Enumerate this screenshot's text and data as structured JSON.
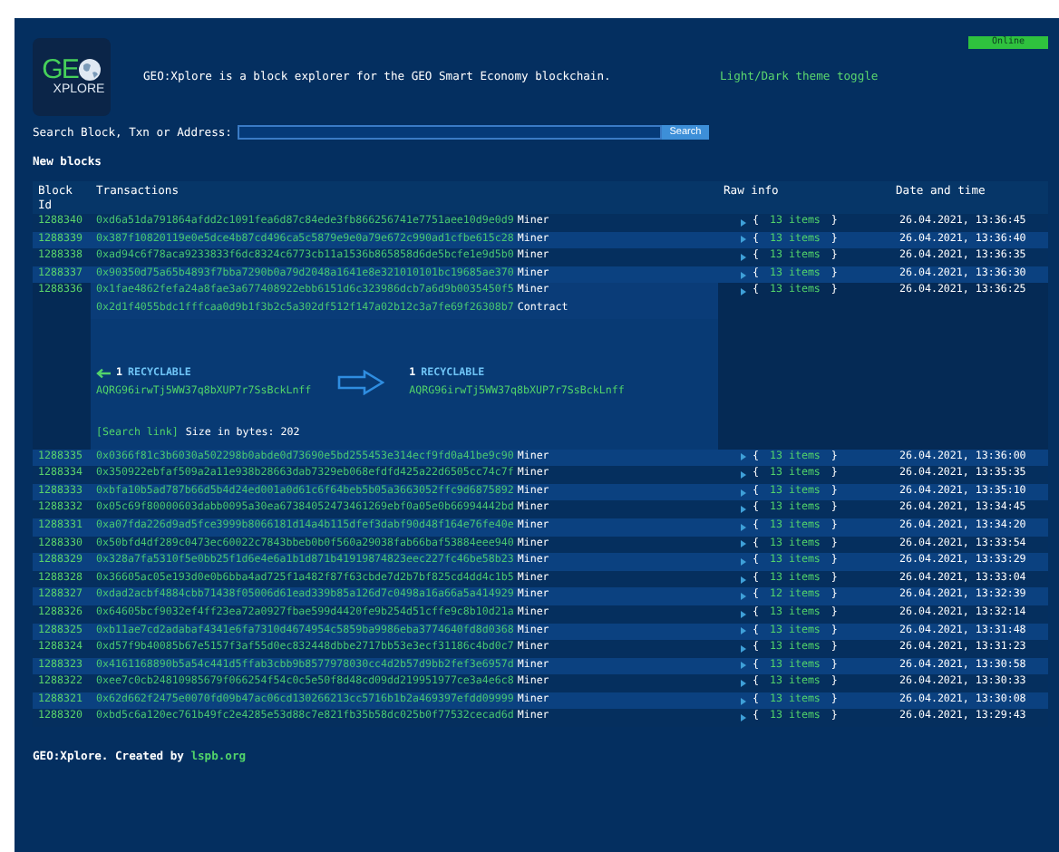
{
  "header": {
    "logo": {
      "top": "GE",
      "bottom": "XPLORE"
    },
    "description": "GEO:Xplore is a block explorer for the GEO Smart Economy blockchain.",
    "theme_toggle": "Light/Dark theme toggle",
    "status": "Online"
  },
  "search": {
    "label": "Search Block, Txn or Address:",
    "button": "Search"
  },
  "section_title": "New blocks",
  "table": {
    "columns": [
      "Block Id",
      "Transactions",
      "Raw info",
      "Date and time"
    ],
    "rows": [
      {
        "block_id": "1288340",
        "expanded": false,
        "transactions": [
          {
            "hash": "0xd6a51da791864afdd2c1091fea6d87c84ede3fb866256741e7751aee10d9e0d9",
            "type": "Miner"
          }
        ],
        "raw_info": {
          "expanded": false,
          "open": "{",
          "count": "13 items",
          "close": "}"
        },
        "date": "26.04.2021, 13:36:45"
      },
      {
        "block_id": "1288339",
        "expanded": false,
        "transactions": [
          {
            "hash": "0x387f10820119e0e5dce4b87cd496ca5c5879e9e0a79e672c990ad1cfbe615c28",
            "type": "Miner"
          }
        ],
        "raw_info": {
          "expanded": false,
          "open": "{",
          "count": "13 items",
          "close": "}"
        },
        "date": "26.04.2021, 13:36:40"
      },
      {
        "block_id": "1288338",
        "expanded": false,
        "transactions": [
          {
            "hash": "0xad94c6f78aca9233833f6dc8324c6773cb11a1536b865858d6de5bcfe1e9d5b0",
            "type": "Miner"
          }
        ],
        "raw_info": {
          "expanded": false,
          "open": "{",
          "count": "13 items",
          "close": "}"
        },
        "date": "26.04.2021, 13:36:35"
      },
      {
        "block_id": "1288337",
        "expanded": false,
        "transactions": [
          {
            "hash": "0x90350d75a65b4893f7bba7290b0a79d2048a1641e8e321010101bc19685ae370",
            "type": "Miner"
          }
        ],
        "raw_info": {
          "expanded": false,
          "open": "{",
          "count": "13 items",
          "close": "}"
        },
        "date": "26.04.2021, 13:36:30"
      },
      {
        "block_id": "1288336",
        "expanded": true,
        "transactions": [
          {
            "hash": "0x1fae4862fefa24a8fae3a677408922ebb6151d6c323986dcb7a6d9b0035450f5",
            "type": "Miner"
          },
          {
            "hash": "0x2d1f4055bdc1fffcaa0d9b1f3b2c5a302df512f147a02b12c3a7fe69f26308b7",
            "type": "Contract"
          }
        ],
        "details": {
          "inputs": [
            {
              "count": "1",
              "label": "RECYCLABLE",
              "address": "AQRG96irwTj5WW37q8bXUP7r7SsBckLnff"
            }
          ],
          "outputs": [
            {
              "count": "1",
              "label": "RECYCLABLE",
              "address": "AQRG96irwTj5WW37q8bXUP7r7SsBckLnff"
            }
          ],
          "search_link": "[Search link]",
          "size": "Size in bytes: 202"
        },
        "raw_info": {
          "expanded": false,
          "open": "{",
          "count": "13 items",
          "close": "}"
        },
        "date": "26.04.2021, 13:36:25"
      },
      {
        "block_id": "1288335",
        "expanded": false,
        "transactions": [
          {
            "hash": "0x0366f81c3b6030a502298b0abde0d73690e5bd255453e314ecf9fd0a41be9c90",
            "type": "Miner"
          }
        ],
        "raw_info": {
          "expanded": false,
          "open": "{",
          "count": "13 items",
          "close": "}"
        },
        "date": "26.04.2021, 13:36:00"
      },
      {
        "block_id": "1288334",
        "expanded": false,
        "transactions": [
          {
            "hash": "0x350922ebfaf509a2a11e938b28663dab7329eb068efdfd425a22d6505cc74c7f",
            "type": "Miner"
          }
        ],
        "raw_info": {
          "expanded": false,
          "open": "{",
          "count": "13 items",
          "close": "}"
        },
        "date": "26.04.2021, 13:35:35"
      },
      {
        "block_id": "1288333",
        "expanded": false,
        "transactions": [
          {
            "hash": "0xbfa10b5ad787b66d5b4d24ed001a0d61c6f64beb5b05a3663052ffc9d6875892",
            "type": "Miner"
          }
        ],
        "raw_info": {
          "expanded": false,
          "open": "{",
          "count": "13 items",
          "close": "}"
        },
        "date": "26.04.2021, 13:35:10"
      },
      {
        "block_id": "1288332",
        "expanded": false,
        "transactions": [
          {
            "hash": "0x05c69f80000603dabb0095a30ea67384052473461269ebf0a05e0b66994442bd",
            "type": "Miner"
          }
        ],
        "raw_info": {
          "expanded": false,
          "open": "{",
          "count": "13 items",
          "close": "}"
        },
        "date": "26.04.2021, 13:34:45"
      },
      {
        "block_id": "1288331",
        "expanded": false,
        "transactions": [
          {
            "hash": "0xa07fda226d9ad5fce3999b8066181d14a4b115dfef3dabf90d48f164e76fe40e",
            "type": "Miner"
          }
        ],
        "raw_info": {
          "expanded": false,
          "open": "{",
          "count": "13 items",
          "close": "}"
        },
        "date": "26.04.2021, 13:34:20"
      },
      {
        "block_id": "1288330",
        "expanded": false,
        "transactions": [
          {
            "hash": "0x50bfd4df289c0473ec60022c7843bbeb0b0f560a29038fab66baf53884eee940",
            "type": "Miner"
          }
        ],
        "raw_info": {
          "expanded": false,
          "open": "{",
          "count": "13 items",
          "close": "}"
        },
        "date": "26.04.2021, 13:33:54"
      },
      {
        "block_id": "1288329",
        "expanded": false,
        "transactions": [
          {
            "hash": "0x328a7fa5310f5e0bb25f1d6e4e6a1b1d871b41919874823eec227fc46be58b23",
            "type": "Miner"
          }
        ],
        "raw_info": {
          "expanded": false,
          "open": "{",
          "count": "13 items",
          "close": "}"
        },
        "date": "26.04.2021, 13:33:29"
      },
      {
        "block_id": "1288328",
        "expanded": false,
        "transactions": [
          {
            "hash": "0x36605ac05e193d0e0b6bba4ad725f1a482f87f63cbde7d2b7bf825cd4dd4c1b5",
            "type": "Miner"
          }
        ],
        "raw_info": {
          "expanded": false,
          "open": "{",
          "count": "13 items",
          "close": "}"
        },
        "date": "26.04.2021, 13:33:04"
      },
      {
        "block_id": "1288327",
        "expanded": false,
        "transactions": [
          {
            "hash": "0xdad2acbf4884cbb71438f05006d61ead339b85a126d7c0498a16a66a5a414929",
            "type": "Miner"
          }
        ],
        "raw_info": {
          "expanded": false,
          "open": "{",
          "count": "12 items",
          "close": "}"
        },
        "date": "26.04.2021, 13:32:39"
      },
      {
        "block_id": "1288326",
        "expanded": false,
        "transactions": [
          {
            "hash": "0x64605bcf9032ef4ff23ea72a0927fbae599d4420fe9b254d51cffe9c8b10d21a",
            "type": "Miner"
          }
        ],
        "raw_info": {
          "expanded": false,
          "open": "{",
          "count": "13 items",
          "close": "}"
        },
        "date": "26.04.2021, 13:32:14"
      },
      {
        "block_id": "1288325",
        "expanded": false,
        "transactions": [
          {
            "hash": "0xb11ae7cd2adabaf4341e6fa7310d4674954c5859ba9986eba3774640fd8d0368",
            "type": "Miner"
          }
        ],
        "raw_info": {
          "expanded": false,
          "open": "{",
          "count": "13 items",
          "close": "}"
        },
        "date": "26.04.2021, 13:31:48"
      },
      {
        "block_id": "1288324",
        "expanded": false,
        "transactions": [
          {
            "hash": "0xd57f9b40085b67e5157f3af55d0ec832448dbbe2717bb53e3ecf31186c4bd0c7",
            "type": "Miner"
          }
        ],
        "raw_info": {
          "expanded": false,
          "open": "{",
          "count": "13 items",
          "close": "}"
        },
        "date": "26.04.2021, 13:31:23"
      },
      {
        "block_id": "1288323",
        "expanded": false,
        "transactions": [
          {
            "hash": "0x4161168890b5a54c441d5ffab3cbb9b8577978030cc4d2b57d9bb2fef3e6957d",
            "type": "Miner"
          }
        ],
        "raw_info": {
          "expanded": false,
          "open": "{",
          "count": "13 items",
          "close": "}"
        },
        "date": "26.04.2021, 13:30:58"
      },
      {
        "block_id": "1288322",
        "expanded": false,
        "transactions": [
          {
            "hash": "0xee7c0cb24810985679f066254f54c0c5e50f8d48cd09dd219951977ce3a4e6c8",
            "type": "Miner"
          }
        ],
        "raw_info": {
          "expanded": false,
          "open": "{",
          "count": "13 items",
          "close": "}"
        },
        "date": "26.04.2021, 13:30:33"
      },
      {
        "block_id": "1288321",
        "expanded": false,
        "transactions": [
          {
            "hash": "0x62d662f2475e0070fd09b47ac06cd130266213cc5716b1b2a469397efdd09999",
            "type": "Miner"
          }
        ],
        "raw_info": {
          "expanded": false,
          "open": "{",
          "count": "13 items",
          "close": "}"
        },
        "date": "26.04.2021, 13:30:08"
      },
      {
        "block_id": "1288320",
        "expanded": false,
        "transactions": [
          {
            "hash": "0xbd5c6a120ec761b49fc2e4285e53d88c7e821fb35b58dc025b0f77532cecad6d",
            "type": "Miner"
          }
        ],
        "raw_info": {
          "expanded": false,
          "open": "{",
          "count": "13 items",
          "close": "}"
        },
        "date": "26.04.2021, 13:29:43"
      }
    ]
  },
  "footer": {
    "text": "GEO:Xplore. Created by ",
    "link": "lspb.org"
  }
}
